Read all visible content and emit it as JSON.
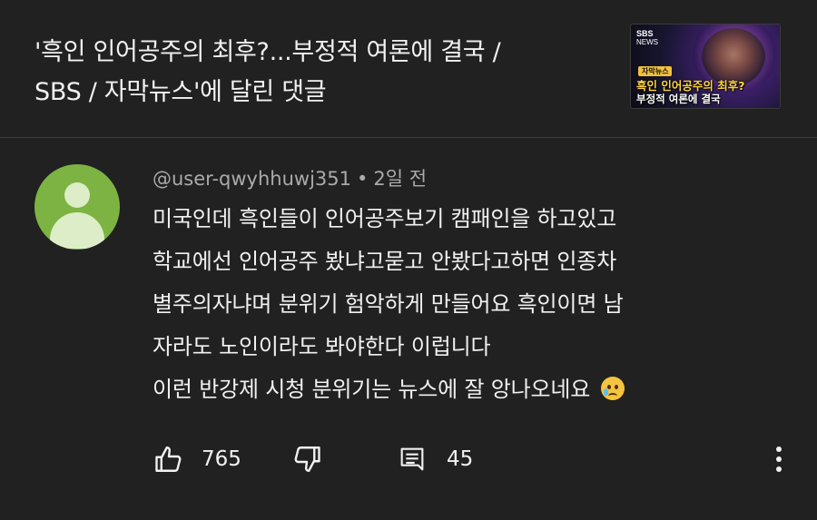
{
  "video": {
    "title": "'흑인 인어공주의 최후?...부정적 여론에 결국 /\nSBS / 자막뉴스'에 달린 댓글",
    "thumbnail": {
      "logo": "SBS",
      "logo_sub": "NEWS",
      "tag": "자막뉴스",
      "line1": "흑인 인어공주의 최후?",
      "line2": "부정적 여론에 결국"
    }
  },
  "comment": {
    "author": "@user-qwyhhuwj351",
    "separator": "•",
    "time": "2일 전",
    "lines": [
      "미국인데 흑인들이 인어공주보기 캠패인을 하고있고",
      "학교에선 인어공주 봤냐고묻고 안봤다고하면 인종차",
      "별주의자냐며 분위기 험악하게 만들어요 흑인이면 남",
      "자라도 노인이라도 봐야한다 이럽니다",
      "이런 반강제 시청 분위기는 뉴스에 잘 앙나오네요"
    ],
    "emoji": "crying-face"
  },
  "actions": {
    "like_count": "765",
    "reply_count": "45"
  },
  "colors": {
    "background": "#212121",
    "text": "#f1f1f1",
    "meta": "#aaaaaa",
    "avatar": "#7cb342"
  }
}
